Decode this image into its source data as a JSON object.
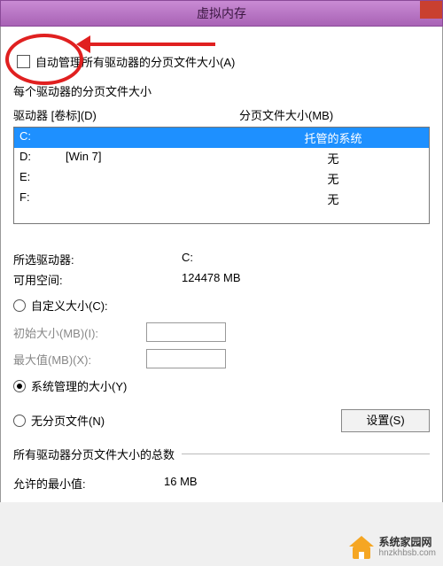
{
  "title": "虚拟内存",
  "auto_manage_label": "自动管理所有驱动器的分页文件大小(A)",
  "group_title": "每个驱动器的分页文件大小",
  "headers": {
    "drive": "驱动器 [卷标](D)",
    "paging": "分页文件大小(MB)"
  },
  "drives": [
    {
      "letter": "C:",
      "label": "",
      "paging": "托管的系统",
      "selected": true
    },
    {
      "letter": "D:",
      "label": "[Win 7]",
      "paging": "无",
      "selected": false
    },
    {
      "letter": "E:",
      "label": "",
      "paging": "无",
      "selected": false
    },
    {
      "letter": "F:",
      "label": "",
      "paging": "无",
      "selected": false
    }
  ],
  "info": {
    "selected_drive_label": "所选驱动器:",
    "selected_drive_value": "C:",
    "free_space_label": "可用空间:",
    "free_space_value": "124478 MB"
  },
  "radios": {
    "custom": "自定义大小(C):",
    "system": "系统管理的大小(Y)",
    "none": "无分页文件(N)"
  },
  "size_inputs": {
    "initial": "初始大小(MB)(I):",
    "max": "最大值(MB)(X):"
  },
  "set_button": "设置(S)",
  "totals": {
    "title": "所有驱动器分页文件大小的总数",
    "min_label": "允许的最小值:",
    "min_value": "16 MB"
  },
  "watermark": {
    "line1": "系统家园网",
    "line2": "hnzkhbsb.com"
  }
}
